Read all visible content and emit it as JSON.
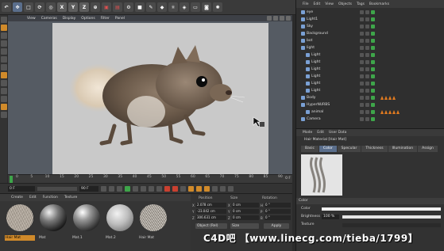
{
  "toolbar": {
    "axis_labels": [
      "X",
      "Y",
      "Z"
    ]
  },
  "viewport": {
    "menu": [
      "View",
      "Cameras",
      "Display",
      "Options",
      "Filter",
      "Panel"
    ]
  },
  "timeline": {
    "ticks": [
      "0",
      "5",
      "10",
      "15",
      "20",
      "25",
      "30",
      "35",
      "40",
      "45",
      "50",
      "55",
      "60",
      "65",
      "70",
      "75",
      "80",
      "85",
      "90"
    ],
    "end_label": "0 F"
  },
  "transport": {
    "current_frame": "0 F",
    "end_frame": "90 F"
  },
  "materials": {
    "menu": [
      "Create",
      "Edit",
      "Function",
      "Texture"
    ],
    "items": [
      {
        "label": "Hair Mat",
        "selected": true
      },
      {
        "label": "Mat",
        "selected": false
      },
      {
        "label": "Mat.1",
        "selected": false
      },
      {
        "label": "Mat.2",
        "selected": false
      },
      {
        "label": "Hair Mat",
        "selected": false
      }
    ]
  },
  "coordinates": {
    "headers": [
      "Position",
      "Size",
      "Rotation"
    ],
    "rows": [
      {
        "axis": "X",
        "pos": "2.078 cm",
        "size_axis": "X",
        "size": "0 cm",
        "rot_axis": "H",
        "rot": "0 °"
      },
      {
        "axis": "Y",
        "pos": "-23.042 cm",
        "size_axis": "Y",
        "size": "0 cm",
        "rot_axis": "P",
        "rot": "0 °"
      },
      {
        "axis": "Z",
        "pos": "306.631 cm",
        "size_axis": "Z",
        "size": "0 cm",
        "rot_axis": "B",
        "rot": "0 °"
      }
    ],
    "mode": "Object (Rel)",
    "size_mode": "Size",
    "apply": "Apply"
  },
  "objects": {
    "menu": [
      "File",
      "Edit",
      "View",
      "Objects",
      "Tags",
      "Bookmarks"
    ],
    "rows": [
      {
        "name": "eye",
        "indent": 0
      },
      {
        "name": "Light1",
        "indent": 0
      },
      {
        "name": "Sky",
        "indent": 0
      },
      {
        "name": "Background",
        "indent": 0
      },
      {
        "name": "bot",
        "indent": 0
      },
      {
        "name": "light",
        "indent": 0
      },
      {
        "name": "Light",
        "indent": 1
      },
      {
        "name": "Light",
        "indent": 1
      },
      {
        "name": "Light",
        "indent": 1
      },
      {
        "name": "Light",
        "indent": 1
      },
      {
        "name": "Light",
        "indent": 1
      },
      {
        "name": "Light",
        "indent": 1
      },
      {
        "name": "Body",
        "indent": 0
      },
      {
        "name": "HyperNURBS",
        "indent": 0
      },
      {
        "name": "animal",
        "indent": 1
      },
      {
        "name": "Camera",
        "indent": 0
      }
    ]
  },
  "attributes": {
    "menu": [
      "Mode",
      "Edit",
      "User Data"
    ],
    "title": "Hair Material [Hair Mat]",
    "tabs": [
      "Basic",
      "Color",
      "Specular",
      "Thickness",
      "Illumination",
      "Assign"
    ],
    "active_tab": "Color",
    "section": "Color",
    "color_label": "Color",
    "brightness_label": "Brightness",
    "brightness_value": "100 %",
    "brightness_fraction": 1.0,
    "texture_label": "Texture"
  },
  "watermark": "C4D吧  【www.linecg.com/tieba/1799】",
  "colors": {
    "accent": "#d08a2a",
    "selection": "#5a6e8c",
    "play_green": "#3ea54a",
    "record_red": "#c94030"
  }
}
